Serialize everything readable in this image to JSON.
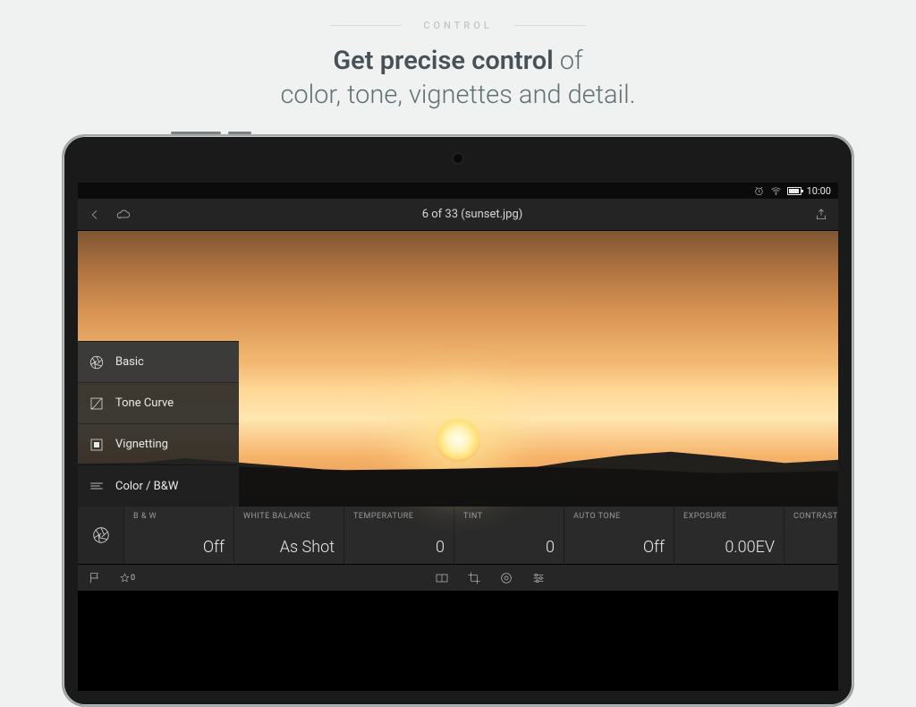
{
  "hero": {
    "kicker": "CONTROL",
    "headline_strong": "Get precise control",
    "headline_rest_1": " of",
    "headline_line2": "color, tone, vignettes and detail."
  },
  "statusbar": {
    "time": "10:00"
  },
  "appbar": {
    "title": "6 of 33 (sunset.jpg)"
  },
  "popup": {
    "items": [
      {
        "icon": "aperture-icon",
        "label": "Basic",
        "selected": true
      },
      {
        "icon": "tone-curve-icon",
        "label": "Tone Curve",
        "selected": false
      },
      {
        "icon": "vignette-icon",
        "label": "Vignetting",
        "selected": false
      },
      {
        "icon": "split-tone-icon",
        "label": "Color / B&W",
        "selected": false
      }
    ]
  },
  "params": [
    {
      "label": "B & W",
      "value": "Off"
    },
    {
      "label": "WHITE BALANCE",
      "value": "As Shot"
    },
    {
      "label": "TEMPERATURE",
      "value": "0"
    },
    {
      "label": "TINT",
      "value": "0"
    },
    {
      "label": "AUTO TONE",
      "value": "Off"
    },
    {
      "label": "EXPOSURE",
      "value": "0.00EV"
    },
    {
      "label": "CONTRAST",
      "value": ""
    }
  ],
  "bottombar": {
    "star_badge": "0"
  }
}
